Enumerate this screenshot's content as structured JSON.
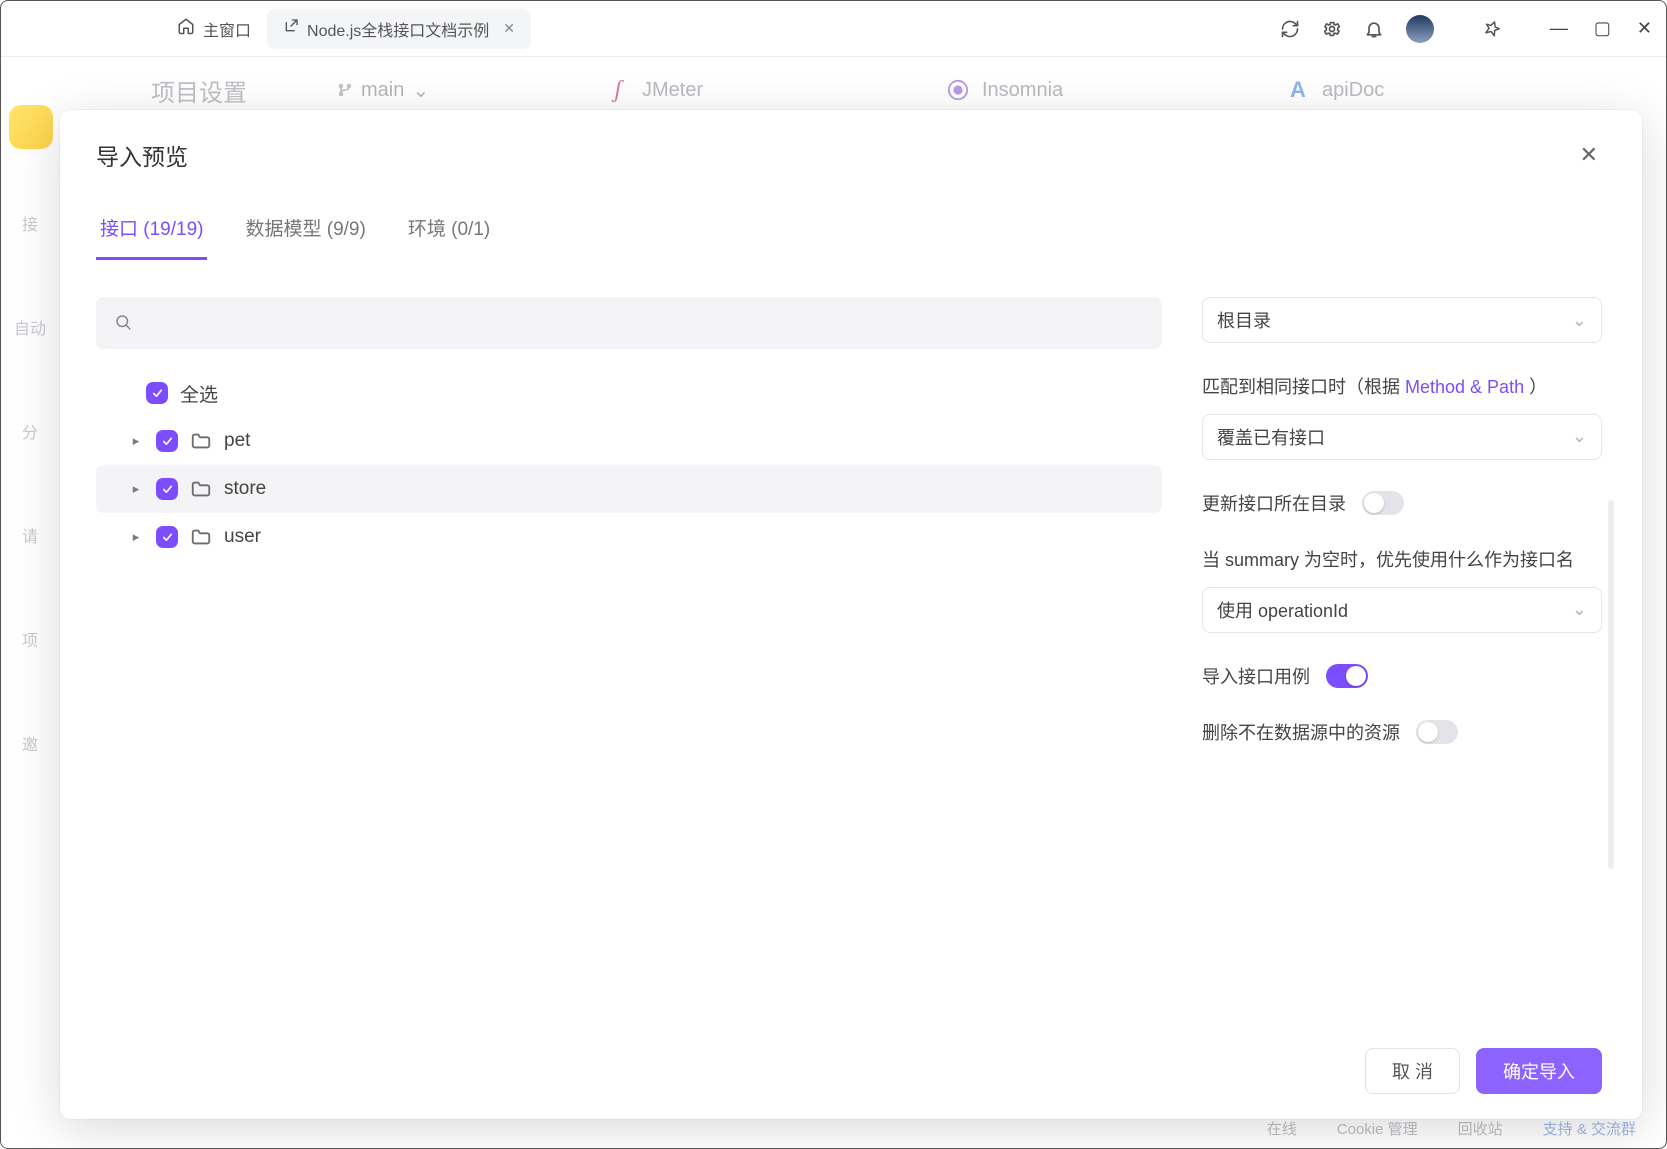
{
  "titlebar": {
    "tab_main": "主窗口",
    "tab_active": "Node.js全栈接口文档示例"
  },
  "background": {
    "project_settings": "项目设置",
    "branch": "main",
    "import_cards": [
      "JMeter",
      "Insomnia",
      "apiDoc"
    ],
    "left_rail": [
      "接",
      "自动",
      "分",
      "请",
      "项",
      "邀"
    ],
    "statusbar": [
      "在线",
      "Cookie 管理",
      "回收站",
      "支持 & 交流群"
    ]
  },
  "modal": {
    "title": "导入预览",
    "tabs": [
      {
        "label": "接口 (19/19)",
        "active": true
      },
      {
        "label": "数据模型 (9/9)",
        "active": false
      },
      {
        "label": "环境 (0/1)",
        "active": false
      }
    ],
    "search_placeholder": "",
    "tree": {
      "select_all": "全选",
      "folders": [
        {
          "name": "pet",
          "checked": true,
          "hover": false
        },
        {
          "name": "store",
          "checked": true,
          "hover": true
        },
        {
          "name": "user",
          "checked": true,
          "hover": false
        }
      ]
    },
    "settings": {
      "root_select": "根目录",
      "match_label_prefix": "匹配到相同接口时（根据 ",
      "match_label_link": "Method & Path",
      "match_label_suffix": " ）",
      "match_select": "覆盖已有接口",
      "update_dir_label": "更新接口所在目录",
      "update_dir_on": false,
      "summary_label": "当 summary 为空时，优先使用什么作为接口名",
      "summary_select": "使用 operationId",
      "import_cases_label": "导入接口用例",
      "import_cases_on": true,
      "delete_absent_label": "删除不在数据源中的资源",
      "delete_absent_on": false
    },
    "footer": {
      "cancel": "取 消",
      "confirm": "确定导入"
    }
  }
}
